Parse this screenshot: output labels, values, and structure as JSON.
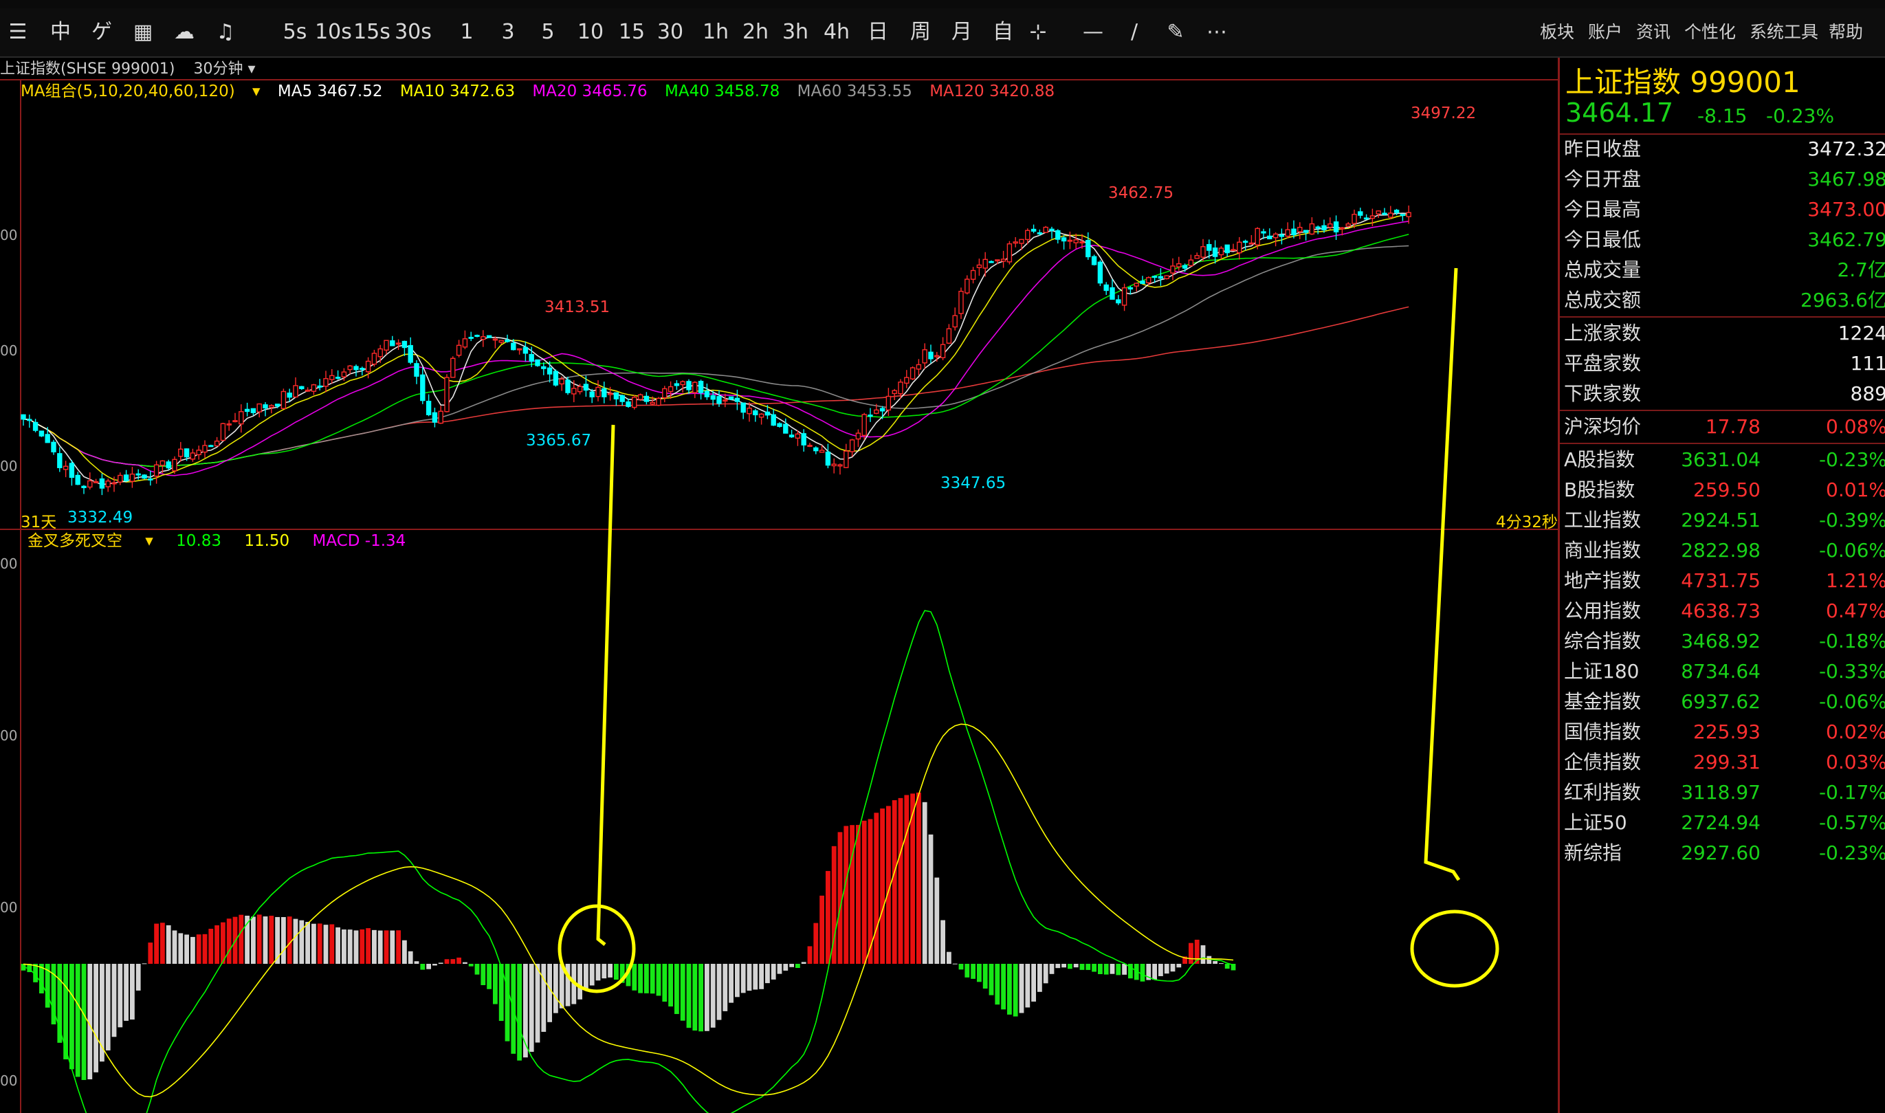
{
  "toolbar": {
    "items": [
      "5s",
      "10s",
      "15s",
      "30s",
      "1",
      "3",
      "5",
      "10",
      "15",
      "30",
      "1h",
      "2h",
      "3h",
      "4h",
      "日",
      "周",
      "月",
      "自"
    ],
    "right_menu": [
      "板块",
      "账户",
      "资讯",
      "个性化",
      "系统工具",
      "帮助"
    ]
  },
  "chart_title": "上证指数(SHSE 999001)",
  "period": "30分钟",
  "ma_legend": {
    "group": "MA组合(5,10,20,40,60,120)",
    "ma5": "MA5 3467.52",
    "ma10": "MA10 3472.63",
    "ma20": "MA20 3465.76",
    "ma40": "MA40 3458.78",
    "ma60": "MA60 3453.55",
    "ma120": "MA120 3420.88"
  },
  "macd_legend": {
    "name": "金叉多死叉空",
    "dif": "10.83",
    "dea": "11.50",
    "macd": "MACD -1.34"
  },
  "status": {
    "days": "31天",
    "countdown": "4分32秒"
  },
  "price_labels": {
    "low1": "3332.49",
    "high1": "3413.51",
    "low2": "3365.67",
    "high2": "3462.75",
    "low3": "3347.65",
    "high3": "3497.22"
  },
  "y_axis": {
    "price": [
      "00",
      "00",
      "00"
    ],
    "macd": [
      "00",
      "00",
      "00",
      "00"
    ]
  },
  "colors": {
    "up": "#ff2a2a",
    "down": "#00ffff",
    "ma5": "#ffffff",
    "ma10": "#ffff00",
    "ma20": "#ff00ff",
    "ma40": "#00ff00",
    "ma60": "#999999",
    "ma120": "#ff4040",
    "macd_pos": "#e81010",
    "macd_neg": "#17e817",
    "macd_fade": "#d4d4d4",
    "annotation": "#ffff00"
  },
  "panel": {
    "title": "上证指数  999001",
    "price": "3464.17",
    "change": "-8.15",
    "change_pct": "-0.23%",
    "stats": [
      {
        "label": "昨日收盘",
        "value": "3472.32",
        "color": "white"
      },
      {
        "label": "今日开盘",
        "value": "3467.98",
        "color": "green"
      },
      {
        "label": "今日最高",
        "value": "3473.00",
        "color": "red"
      },
      {
        "label": "今日最低",
        "value": "3462.79",
        "color": "green"
      },
      {
        "label": "总成交量",
        "value": "2.7亿",
        "color": "green"
      },
      {
        "label": "总成交额",
        "value": "2963.6亿",
        "color": "green"
      }
    ],
    "breadth": [
      {
        "label": "上涨家数",
        "value": "1224",
        "color": "white"
      },
      {
        "label": "平盘家数",
        "value": "111",
        "color": "white"
      },
      {
        "label": "下跌家数",
        "value": "889",
        "color": "white"
      }
    ],
    "avg": {
      "label": "沪深均价",
      "value": "17.78",
      "pct": "0.08%"
    },
    "indices": [
      {
        "label": "A股指数",
        "value": "3631.04",
        "pct": "-0.23%",
        "color": "green"
      },
      {
        "label": "B股指数",
        "value": "259.50",
        "pct": "0.01%",
        "color": "red"
      },
      {
        "label": "工业指数",
        "value": "2924.51",
        "pct": "-0.39%",
        "color": "green"
      },
      {
        "label": "商业指数",
        "value": "2822.98",
        "pct": "-0.06%",
        "color": "green"
      },
      {
        "label": "地产指数",
        "value": "4731.75",
        "pct": "1.21%",
        "color": "red"
      },
      {
        "label": "公用指数",
        "value": "4638.73",
        "pct": "0.47%",
        "color": "red"
      },
      {
        "label": "综合指数",
        "value": "3468.92",
        "pct": "-0.18%",
        "color": "green"
      },
      {
        "label": "上证180",
        "value": "8734.64",
        "pct": "-0.33%",
        "color": "green"
      },
      {
        "label": "基金指数",
        "value": "6937.62",
        "pct": "-0.06%",
        "color": "green"
      },
      {
        "label": "国债指数",
        "value": "225.93",
        "pct": "0.02%",
        "color": "red"
      },
      {
        "label": "企债指数",
        "value": "299.31",
        "pct": "0.03%",
        "color": "red"
      },
      {
        "label": "红利指数",
        "value": "3118.97",
        "pct": "-0.17%",
        "color": "green"
      },
      {
        "label": "上证50",
        "value": "2724.94",
        "pct": "-0.57%",
        "color": "green"
      },
      {
        "label": "新综指",
        "value": "2927.60",
        "pct": "-0.23%",
        "color": "green"
      }
    ]
  },
  "chart_data": {
    "type": "candlestick",
    "ylim": [
      3320,
      3505
    ],
    "close_anchors": [
      [
        0,
        3370
      ],
      [
        10,
        3340
      ],
      [
        20,
        3345
      ],
      [
        28,
        3355
      ],
      [
        38,
        3375
      ],
      [
        48,
        3385
      ],
      [
        55,
        3395
      ],
      [
        62,
        3405
      ],
      [
        68,
        3370
      ],
      [
        72,
        3405
      ],
      [
        80,
        3405
      ],
      [
        90,
        3385
      ],
      [
        100,
        3378
      ],
      [
        110,
        3385
      ],
      [
        120,
        3375
      ],
      [
        130,
        3360
      ],
      [
        134,
        3350
      ],
      [
        140,
        3372
      ],
      [
        150,
        3400
      ],
      [
        158,
        3440
      ],
      [
        168,
        3455
      ],
      [
        174,
        3450
      ],
      [
        180,
        3425
      ],
      [
        186,
        3433
      ],
      [
        196,
        3446
      ],
      [
        206,
        3455
      ],
      [
        216,
        3457
      ],
      [
        224,
        3465
      ],
      [
        228,
        3464
      ]
    ],
    "macd_hist_anchors": [
      [
        0,
        -10
      ],
      [
        10,
        -170
      ],
      [
        18,
        -80
      ],
      [
        20,
        0
      ],
      [
        22,
        60
      ],
      [
        28,
        40
      ],
      [
        36,
        70
      ],
      [
        42,
        70
      ],
      [
        48,
        60
      ],
      [
        55,
        50
      ],
      [
        62,
        50
      ],
      [
        64,
        20
      ],
      [
        66,
        -10
      ],
      [
        70,
        5
      ],
      [
        72,
        8
      ],
      [
        74,
        -5
      ],
      [
        76,
        -30
      ],
      [
        82,
        -140
      ],
      [
        90,
        -60
      ],
      [
        96,
        -20
      ],
      [
        104,
        -45
      ],
      [
        112,
        -100
      ],
      [
        120,
        -40
      ],
      [
        128,
        -5
      ],
      [
        136,
        200
      ],
      [
        148,
        250
      ],
      [
        154,
        0
      ],
      [
        156,
        -20
      ],
      [
        164,
        -75
      ],
      [
        172,
        -5
      ],
      [
        180,
        -15
      ],
      [
        186,
        -25
      ],
      [
        190,
        -10
      ],
      [
        194,
        35
      ],
      [
        197,
        5
      ],
      [
        200,
        -10
      ]
    ],
    "annotations": [
      "arrow-left",
      "circle-left",
      "arrow-right",
      "circle-right"
    ]
  }
}
